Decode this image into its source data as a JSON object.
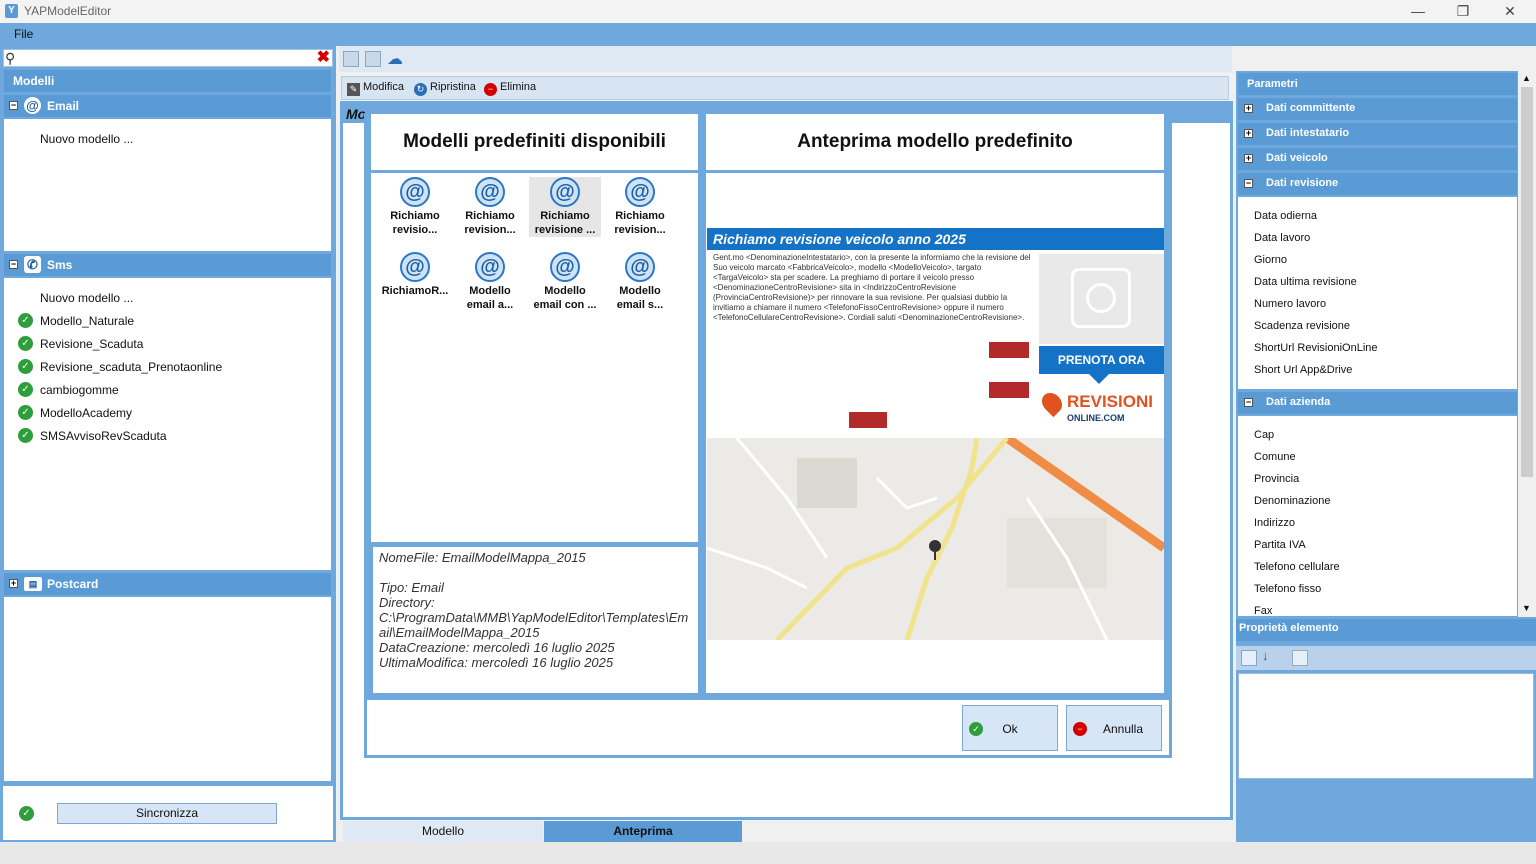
{
  "window": {
    "title": "YAPModelEditor",
    "minimize": "—",
    "restore": "❐",
    "close": "✕"
  },
  "menu": {
    "file": "File"
  },
  "left": {
    "search_placeholder": "",
    "header": "Modelli",
    "groups": {
      "email": {
        "label": "Email",
        "items": [
          "Nuovo modello ..."
        ]
      },
      "sms": {
        "label": "Sms",
        "new_item": "Nuovo modello ...",
        "items": [
          "Modello_Naturale",
          "Revisione_Scaduta",
          "Revisione_scaduta_Prenotaonline",
          "cambiogomme",
          "ModelloAcademy",
          "SMSAvvisoRevScaduta"
        ]
      },
      "postcard": {
        "label": "Postcard"
      }
    },
    "sync_label": "Sincronizza"
  },
  "actions": {
    "modifica": "Modifica",
    "ripristina": "Ripristina",
    "elimina": "Elimina"
  },
  "main": {
    "partial_label": "Mo"
  },
  "dialog": {
    "left_title": "Modelli predefiniti disponibili",
    "right_title": "Anteprima modello predefinito",
    "tiles": [
      {
        "l1": "Richiamo",
        "l2": "revisio..."
      },
      {
        "l1": "Richiamo",
        "l2": "revision..."
      },
      {
        "l1": "Richiamo",
        "l2": "revisione ..."
      },
      {
        "l1": "Richiamo",
        "l2": "revision..."
      },
      {
        "l1": "RichiamoR...",
        "l2": ""
      },
      {
        "l1": "Modello",
        "l2": "email a..."
      },
      {
        "l1": "Modello",
        "l2": "email con ..."
      },
      {
        "l1": "Modello",
        "l2": "email s..."
      }
    ],
    "info": {
      "nomefile": "NomeFile: EmailModelMappa_2015",
      "tipo": "Tipo: Email",
      "directory_label": "Directory:",
      "directory_value": "C:\\ProgramData\\MMB\\YapModelEditor\\Templates\\Email\\EmailModelMappa_2015",
      "creazione": "DataCreazione: mercoledì 16 luglio 2025",
      "modifica": "UltimaModifica: mercoledì 16 luglio 2025"
    },
    "ok": "Ok",
    "annulla": "Annulla"
  },
  "preview": {
    "header": "Richiamo revisione veicolo anno 2025",
    "body": "Gent.mo <DenominazioneIntestatario>, con la presente la informiamo che la revisione del Suo veicolo marcato <FabbricaVeicolo>, modello <ModelloVeicolo>, targato <TargaVeicolo> sta per scadere. La preghiamo di portare il veicolo presso <DenominazioneCentroRevisione> sita in <IndirizzoCentroRevisione (ProvinciaCentroRevisione)> per rinnovare la sua revisione. Per qualsiasi dubbio la invitiamo a chiamare il numero <TelefonoFissoCentroRevisione> oppure il numero <TelefonoCellulareCentroRevisione>. Cordiali saluti <DenominazioneCentroRevisione>.",
    "cta": "PRENOTA ORA",
    "logo_big": "REVISIONI",
    "logo_small": "ONLINE.COM"
  },
  "right": {
    "header": "Parametri",
    "sections": {
      "committente": "Dati committente",
      "intestatario": "Dati intestatario",
      "veicolo": "Dati veicolo",
      "revisione": "Dati revisione",
      "azienda": "Dati azienda"
    },
    "revisione_items": [
      "Data odierna",
      "Data lavoro",
      "Giorno",
      "Data ultima revisione",
      "Numero lavoro",
      "Scadenza revisione",
      "ShortUrl RevisioniOnLine",
      "Short Url App&Drive"
    ],
    "azienda_items": [
      "Cap",
      "Comune",
      "Provincia",
      "Denominazione",
      "Indirizzo",
      "Partita IVA",
      "Telefono cellulare",
      "Telefono fisso",
      "Fax"
    ],
    "props_header": "Proprietà elemento"
  },
  "tabs": {
    "modello": "Modello",
    "anteprima": "Anteprima"
  },
  "colors": {
    "panel_blue": "#6fa8dc",
    "header_blue": "#5a9bd5",
    "accent_blue": "#1473c7",
    "check_green": "#2e9e3b"
  }
}
